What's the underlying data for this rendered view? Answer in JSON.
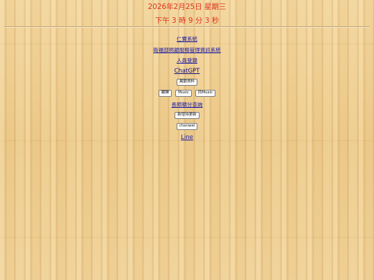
{
  "header": {
    "date": "2026年2月25日 星期三",
    "time": "下午 3 時 9 分 3 秒"
  },
  "menu": {
    "link_1": "仁寶系統",
    "link_2": "衛福部照顧服務管理資訊系統",
    "link_3": "人員登錄",
    "link_4": "ChatGPT",
    "button_1": "異動資料",
    "button_row": [
      "翻譯",
      "Music",
      "同Music"
    ],
    "link_5": "長照積分查詢",
    "button_2": "新增待更新",
    "button_3": "chanwei",
    "link_6": "Line"
  }
}
